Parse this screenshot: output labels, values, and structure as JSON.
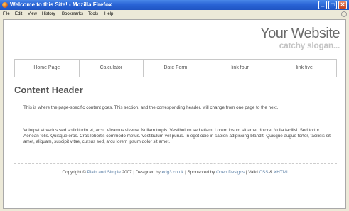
{
  "window": {
    "title": "Welcome to this Site! - Mozilla Firefox",
    "controls": {
      "minimize": "_",
      "maximize": "□",
      "close": "✕"
    }
  },
  "menubar": {
    "items": [
      "File",
      "Edit",
      "View",
      "History",
      "Bookmarks",
      "Tools",
      "Help"
    ]
  },
  "site": {
    "title": "Your Website",
    "slogan": "catchy slogan..."
  },
  "nav": {
    "items": [
      "Home Page",
      "Calculator",
      "Date Form",
      "link four",
      "link five"
    ]
  },
  "content": {
    "header": "Content Header",
    "paragraph1": "This is where the page-specific content goes. This section, and the corresponding header, will change from one page to the next.",
    "paragraph2": "Volutpat at varius sed sollicitudin et, arcu. Vivamus viverra. Nullam turpis. Vestibulum sed etiam. Lorem ipsum sit amet dolore. Nulla facilisi. Sed tortor. Aenean felis. Quisque eros. Cras lobortis commodo metus. Vestibulum vel purus. In eget odio in sapien adipiscing blandit. Quisque augue tortor, facilisis sit amet, aliquam, suscipit vitae, cursus sed, arcu lorem ipsum dolor sit amet."
  },
  "footer": {
    "copyright_prefix": "Copyright ©",
    "plain_simple": "Plain and Simple",
    "year_designed": "2007 | Designed by",
    "designer": "edg3.co.uk",
    "sponsored": "| Sponsored by",
    "sponsor": "Open Designs",
    "valid": "| Valid",
    "css": "CSS",
    "amp": "&",
    "xhtml": "XHTML"
  }
}
